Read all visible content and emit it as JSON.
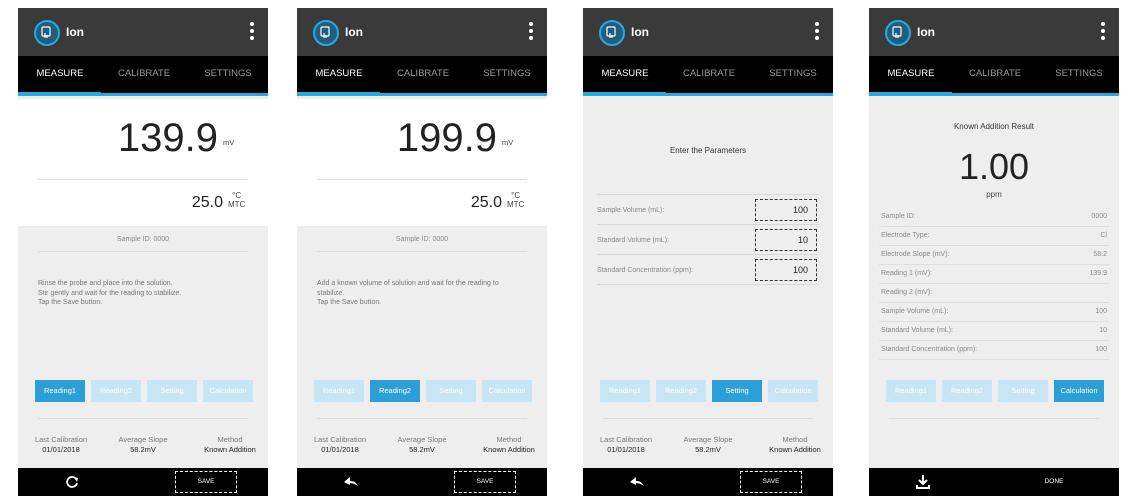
{
  "app": {
    "title": "Ion"
  },
  "tabs": [
    "MEASURE",
    "CALIBRATE",
    "SETTINGS"
  ],
  "reading": {
    "temp_value": "25.0",
    "temp_unit": "°C",
    "temp_mode": "MTC",
    "mv_unit": "mV",
    "sample_id": "Sample ID: 0000"
  },
  "steps": [
    "Reading1",
    "Reading2",
    "Setting",
    "Calculation"
  ],
  "footer": {
    "last_calibration_label": "Last Calibration",
    "last_calibration_value": "01/01/2018",
    "avg_slope_label": "Average Slope",
    "avg_slope_value": "58.2mV",
    "method_label": "Method",
    "method_value": "Known Addition"
  },
  "screen1": {
    "value": "139.9",
    "instructions": "Rinse the probe and place into the solution.\nStir gently and wait for the reading to stabilize.\nTap the Save button.",
    "save_label": "SAVE",
    "left_icon": "refresh-icon"
  },
  "screen2": {
    "value": "199.9",
    "instructions": "Add a known volume of solution and wait for the reading to stabilize.\nTap the Save button.",
    "save_label": "SAVE",
    "left_icon": "back-arrow-icon"
  },
  "screen3": {
    "title": "Enter the Parameters",
    "params": [
      {
        "label": "Sample Volume (mL):",
        "value": "100"
      },
      {
        "label": "Standard Volume (mL):",
        "value": "10"
      },
      {
        "label": "Standard Concentration (ppm):",
        "value": "100"
      }
    ],
    "save_label": "SAVE",
    "left_icon": "back-arrow-icon"
  },
  "screen4": {
    "title": "Known Addition Result",
    "value": "1.00",
    "unit": "ppm",
    "rows": [
      {
        "label": "Sample ID:",
        "value": "0000"
      },
      {
        "label": "Electrode Type:",
        "value": "Cl"
      },
      {
        "label": "Electrode Slope (mV):",
        "value": "58.2"
      },
      {
        "label": "Reading 1 (mV):",
        "value": "139.9"
      },
      {
        "label": "Reading 2 (mV):",
        "value": ""
      },
      {
        "label": "Sample Volume (mL):",
        "value": "100"
      },
      {
        "label": "Standard Volume (mL):",
        "value": "10"
      },
      {
        "label": "Standard Concentration (ppm):",
        "value": "100"
      }
    ],
    "done_label": "DONE",
    "left_icon": "download-icon"
  },
  "colors": {
    "accent": "#29a9e1",
    "step_active": "#2b9fd6",
    "step_inactive": "#c6e6f6"
  }
}
